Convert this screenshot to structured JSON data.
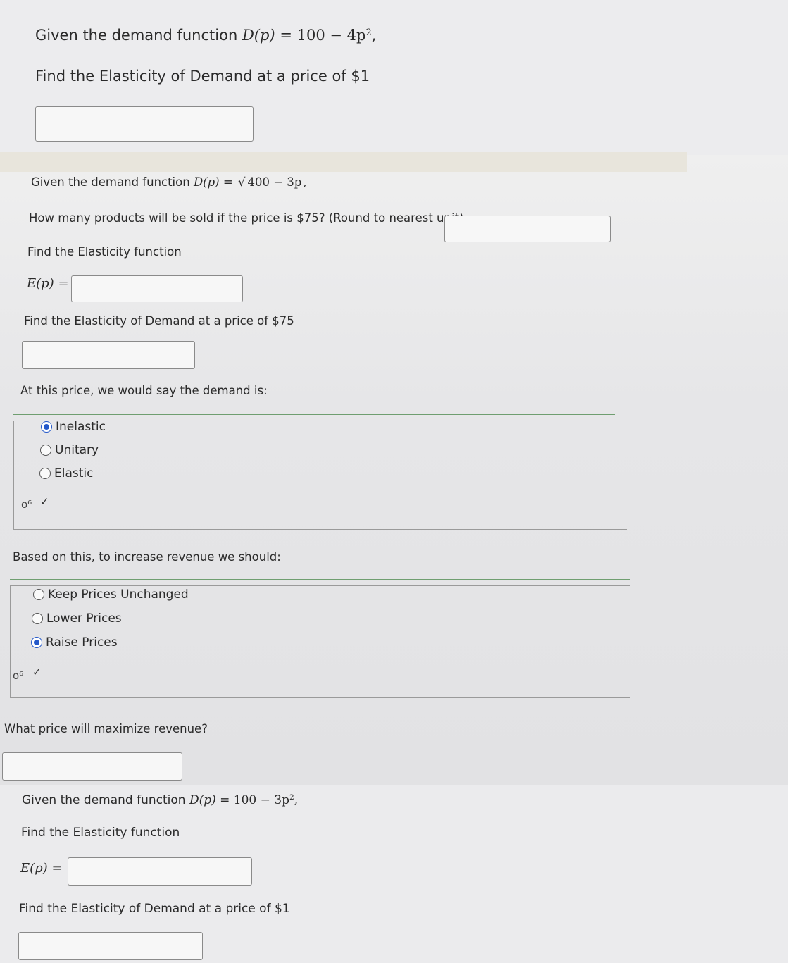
{
  "q1": {
    "prompt": "Given the demand function",
    "func_lhs": "D(p)",
    "func_rhs": "100 − 4p",
    "exp": "2",
    "tail": ",",
    "ask": "Find the Elasticity of Demand at a price of $1",
    "answer": ""
  },
  "q2": {
    "prompt": "Given the demand function",
    "func_lhs": "D(p)",
    "radicand": "400 − 3p",
    "tail": ",",
    "products_ask": "How many products will be sold if the price is $75? (Round to nearest unit)",
    "products_answer": "",
    "elasticity_fn_ask": "Find the Elasticity function",
    "ep_label": "E(p)",
    "ep_answer": "",
    "elasticity_at_ask": "Find the Elasticity of Demand at a price of $75",
    "elasticity_at_answer": "",
    "demand_ask": "At this price, we would say the demand is:",
    "demand_options": [
      "Inelastic",
      "Unitary",
      "Elastic"
    ],
    "demand_selected": "Inelastic",
    "revenue_ask": "Based on this, to increase revenue we should:",
    "revenue_options": [
      "Keep Prices Unchanged",
      "Lower Prices",
      "Raise Prices"
    ],
    "revenue_selected": "Raise Prices",
    "maxprice_ask": "What price will maximize revenue?",
    "maxprice_answer": ""
  },
  "q3": {
    "prompt": "Given the demand function",
    "func_lhs": "D(p)",
    "func_rhs": "100 − 3p",
    "exp": "2",
    "tail": ",",
    "elasticity_fn_ask": "Find the Elasticity function",
    "ep_label": "E(p)",
    "ep_answer": "",
    "elasticity_at_ask": "Find the Elasticity of Demand at a price of $1",
    "elasticity_at_answer": ""
  },
  "symbols": {
    "check": "✓",
    "key": "o⁶",
    "equals": "="
  },
  "colors": {
    "radio_selected": "#2458c9",
    "group_border": "#9a9a9a",
    "group_accent": "#6f9e70"
  },
  "icons": [
    "key-icon",
    "check-icon"
  ]
}
